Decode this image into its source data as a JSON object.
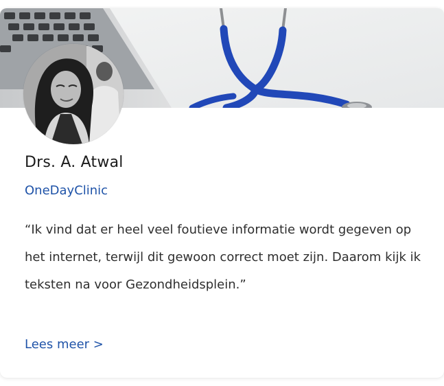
{
  "profile": {
    "name": "Drs. A. Atwal",
    "organization": "OneDayClinic",
    "quote": "“Ik vind dat er heel veel foutieve informatie wordt gegeven op het internet, terwijl dit gewoon correct moet zijn. Daarom kijk ik teksten na voor Gezondheidsplein.”",
    "read_more_label": "Lees meer >"
  },
  "colors": {
    "link": "#1f53a8",
    "text": "#2e2e2e",
    "stethoscope": "#2148b8"
  }
}
